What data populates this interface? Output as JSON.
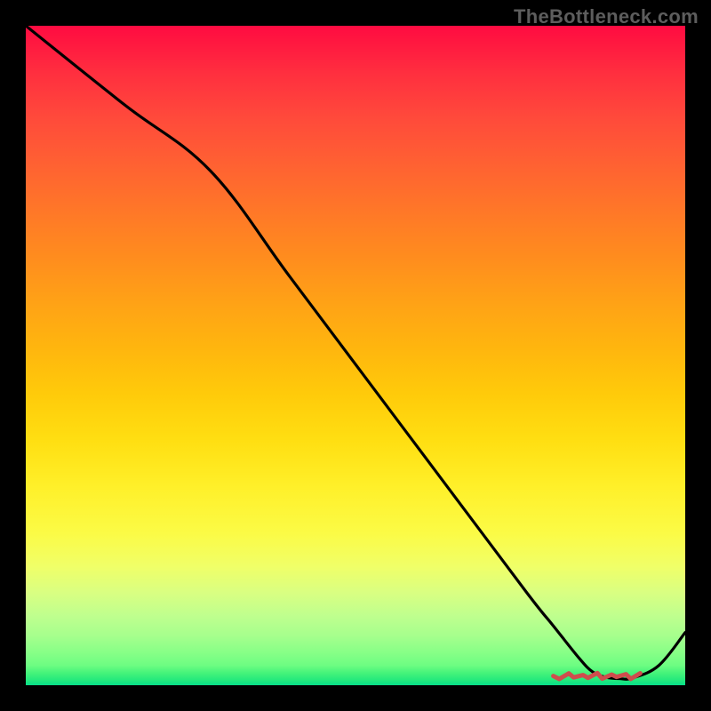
{
  "watermark": "TheBottleneck.com",
  "chart_data": {
    "type": "line",
    "title": "",
    "xlabel": "",
    "ylabel": "",
    "xlim": [
      0,
      100
    ],
    "ylim": [
      0,
      100
    ],
    "series": [
      {
        "name": "curve",
        "x": [
          0,
          15,
          28,
          40,
          52,
          64,
          76,
          80,
          84,
          86,
          88,
          90,
          92,
          96,
          100
        ],
        "values": [
          100,
          88,
          78,
          62,
          46,
          30,
          14,
          9,
          4,
          2,
          1.2,
          1.0,
          1.1,
          3,
          8
        ]
      }
    ],
    "annotation": {
      "name": "bottom-scribble",
      "x_range": [
        80,
        93
      ],
      "y": 1.4
    },
    "colors": {
      "line": "#000000",
      "scribble": "#cf4d4d",
      "background_top": "#ff0b41",
      "background_bottom": "#07df89"
    }
  }
}
